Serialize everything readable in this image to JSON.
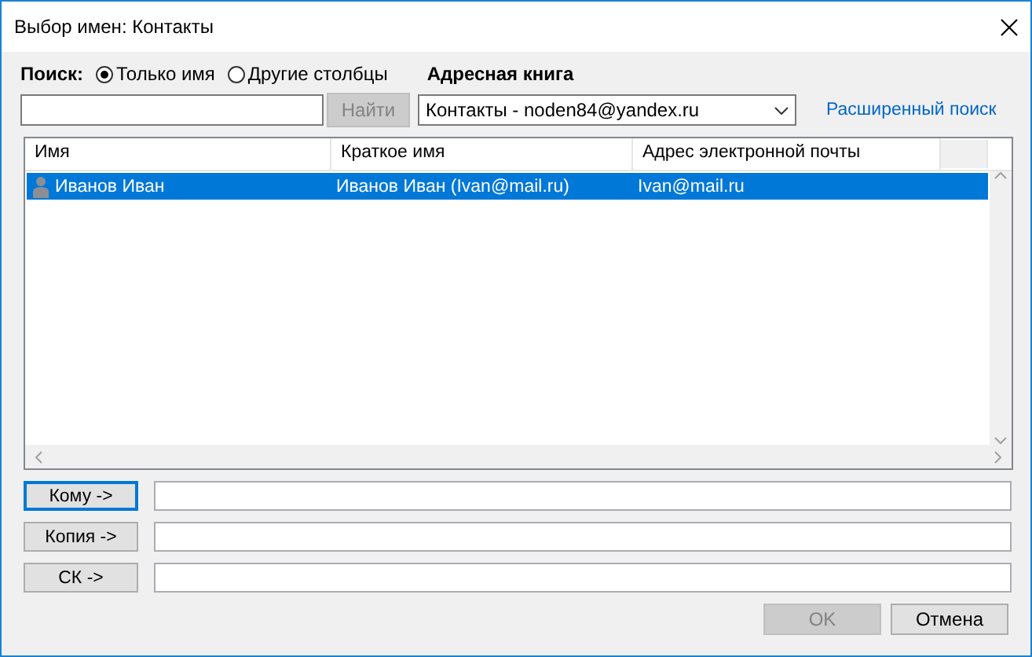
{
  "window": {
    "title": "Выбор имен: Контакты"
  },
  "search": {
    "label": "Поиск:",
    "options": [
      {
        "label": "Только имя",
        "selected": true
      },
      {
        "label": "Другие столбцы",
        "selected": false
      }
    ],
    "button": {
      "label": "Найти",
      "disabled": true
    }
  },
  "address_book": {
    "label": "Адресная книга",
    "value": "Контакты - noden84@yandex.ru"
  },
  "advanced_search_link": "Расширенный поиск",
  "table": {
    "columns": [
      "Имя",
      "Краткое имя",
      "Адрес электронной почты"
    ],
    "rows": [
      {
        "cells": [
          "Иванов Иван",
          "Иванов Иван (Ivan@mail.ru)",
          "Ivan@mail.ru"
        ],
        "selected": true
      }
    ]
  },
  "recipients": [
    {
      "label": "Кому ->",
      "focused": true
    },
    {
      "label": "Копия ->",
      "focused": false
    },
    {
      "label": "СК ->",
      "focused": false
    }
  ],
  "buttons": [
    {
      "label": "OK",
      "disabled": true
    },
    {
      "label": "Отмена",
      "disabled": false
    }
  ]
}
